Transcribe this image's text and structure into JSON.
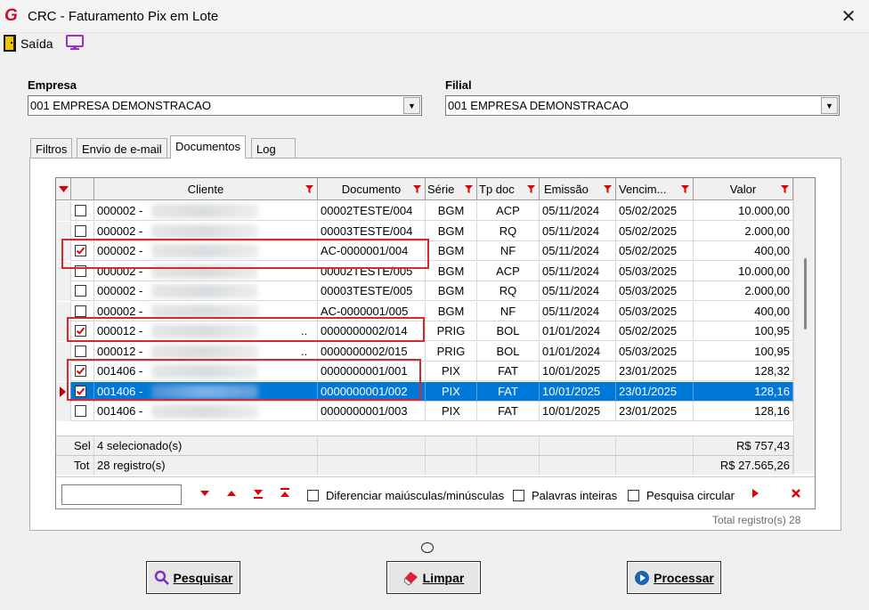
{
  "window": {
    "title": "CRC - Faturamento Pix em Lote",
    "logo_text": "G"
  },
  "toolbar": {
    "exit_label": "Saída"
  },
  "empresa": {
    "label": "Empresa",
    "value": "001 EMPRESA DEMONSTRACAO"
  },
  "filial": {
    "label": "Filial",
    "value": "001 EMPRESA DEMONSTRACAO"
  },
  "tabs": [
    {
      "label": "Filtros"
    },
    {
      "label": "Envio de e-mail"
    },
    {
      "label": "Documentos"
    },
    {
      "label": "Log"
    }
  ],
  "grid": {
    "columns": [
      "Cliente",
      "Documento",
      "Série",
      "Tp doc",
      "Emissão",
      "Vencim...",
      "Valor"
    ],
    "rows": [
      {
        "checked": false,
        "cliente": "000002 -",
        "documento": "00002TESTE/004",
        "serie": "BGM",
        "tpdoc": "ACP",
        "emissao": "05/11/2024",
        "venc": "05/02/2025",
        "valor": "10.000,00"
      },
      {
        "checked": false,
        "cliente": "000002 -",
        "documento": "00003TESTE/004",
        "serie": "BGM",
        "tpdoc": "RQ",
        "emissao": "05/11/2024",
        "venc": "05/02/2025",
        "valor": "2.000,00"
      },
      {
        "checked": true,
        "cliente": "000002 -",
        "documento": "AC-0000001/004",
        "serie": "BGM",
        "tpdoc": "NF",
        "emissao": "05/11/2024",
        "venc": "05/02/2025",
        "valor": "400,00"
      },
      {
        "checked": false,
        "cliente": "000002 -",
        "documento": "00002TESTE/005",
        "serie": "BGM",
        "tpdoc": "ACP",
        "emissao": "05/11/2024",
        "venc": "05/03/2025",
        "valor": "10.000,00"
      },
      {
        "checked": false,
        "cliente": "000002 -",
        "documento": "00003TESTE/005",
        "serie": "BGM",
        "tpdoc": "RQ",
        "emissao": "05/11/2024",
        "venc": "05/03/2025",
        "valor": "2.000,00"
      },
      {
        "checked": false,
        "cliente": "000002 -",
        "documento": "AC-0000001/005",
        "serie": "BGM",
        "tpdoc": "NF",
        "emissao": "05/11/2024",
        "venc": "05/03/2025",
        "valor": "400,00"
      },
      {
        "checked": true,
        "cliente": "000012 -",
        "documento": "0000000002/014",
        "serie": "PRIG",
        "tpdoc": "BOL",
        "emissao": "01/01/2024",
        "venc": "05/02/2025",
        "valor": "100,95"
      },
      {
        "checked": false,
        "cliente": "000012 -",
        "documento": "0000000002/015",
        "serie": "PRIG",
        "tpdoc": "BOL",
        "emissao": "01/01/2024",
        "venc": "05/03/2025",
        "valor": "100,95"
      },
      {
        "checked": true,
        "cliente": "001406 -",
        "documento": "0000000001/001",
        "serie": "PIX",
        "tpdoc": "FAT",
        "emissao": "10/01/2025",
        "venc": "23/01/2025",
        "valor": "128,32"
      },
      {
        "checked": true,
        "cliente": "001406 -",
        "documento": "0000000001/002",
        "serie": "PIX",
        "tpdoc": "FAT",
        "emissao": "10/01/2025",
        "venc": "23/01/2025",
        "valor": "128,16"
      },
      {
        "checked": false,
        "cliente": "001406 -",
        "documento": "0000000001/003",
        "serie": "PIX",
        "tpdoc": "FAT",
        "emissao": "10/01/2025",
        "venc": "23/01/2025",
        "valor": "128,16"
      }
    ],
    "footer": {
      "sel_label": "Sel",
      "sel_text": "4 selecionado(s)",
      "sel_value": "R$ 757,43",
      "tot_label": "Tot",
      "tot_text": "28 registro(s)",
      "tot_value": "R$ 27.565,26"
    }
  },
  "search": {
    "opt_case": "Diferenciar maiúsculas/minúsculas",
    "opt_words": "Palavras inteiras",
    "opt_circular": "Pesquisa circular"
  },
  "total_registros": "Total registro(s) 28",
  "buttons": {
    "pesquisar": "Pesquisar",
    "limpar": "Limpar",
    "processar": "Processar"
  },
  "colors": {
    "selection": "#0078d7",
    "accent_red": "#d42a2a"
  }
}
